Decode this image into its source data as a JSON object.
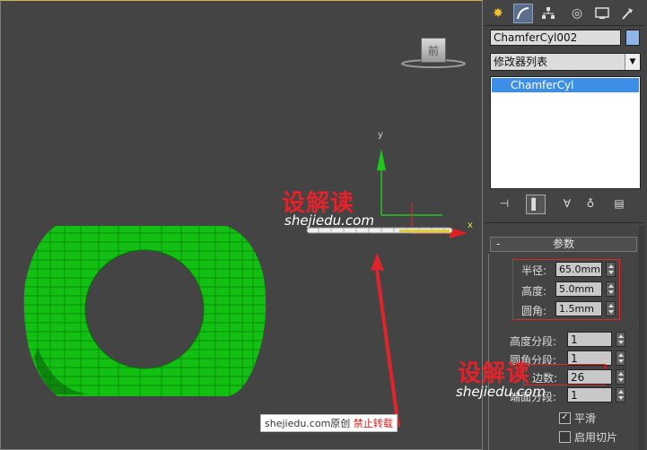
{
  "object_name": "ChamferCyl002",
  "modifier_list_label": "修改器列表",
  "modifier_stack": [
    "ChamferCyl"
  ],
  "rollout": {
    "collapse_symbol": "-",
    "title": "参数"
  },
  "params_highlight": [
    {
      "label": "半径:",
      "value": "65.0mm"
    },
    {
      "label": "高度:",
      "value": "5.0mm"
    },
    {
      "label": "圆角:",
      "value": "1.5mm"
    }
  ],
  "segment_params": [
    {
      "label": "高度分段:",
      "value": "1"
    },
    {
      "label": "圆角分段:",
      "value": "1"
    },
    {
      "label": "边数:",
      "value": "26"
    },
    {
      "label": "端面分段:",
      "value": "1"
    }
  ],
  "checkboxes": [
    {
      "label": "平滑",
      "checked": true
    },
    {
      "label": "启用切片",
      "checked": false
    }
  ],
  "viewcube_label": "前",
  "axis": {
    "y": "y",
    "x": "x"
  },
  "watermark": {
    "brand": "设解读",
    "site": "shejiedu.com"
  },
  "footer": {
    "site": "shejiedu.com",
    "original": "原创",
    "notice": "禁止转载"
  },
  "colors": {
    "object_swatch": "#8fb4e6",
    "selection": "#3d8ee6",
    "torus_green": "#14c414",
    "highlight_box": "#e02828"
  }
}
